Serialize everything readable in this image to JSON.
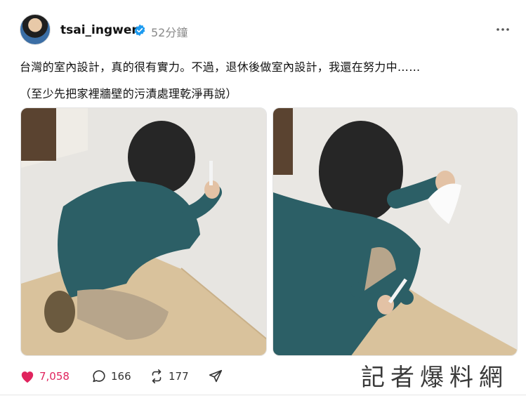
{
  "post": {
    "username": "tsai_ingwen",
    "time_ago": "52分鐘",
    "text_line1": "台灣的室內設計，真的很有實力。不過，退休後做室內設計，我還在努力中……",
    "text_line2": "（至少先把家裡牆壁的污漬處理乾淨再說）"
  },
  "actions": {
    "likes": "7,058",
    "replies": "166",
    "reposts": "177"
  },
  "watermark": "記者爆料網",
  "colors": {
    "like": "#e0245e",
    "verified": "#1d9bf0",
    "wall": "#e9e7e3",
    "floor": "#d8c4a2",
    "sweater": "#2c5f66"
  }
}
